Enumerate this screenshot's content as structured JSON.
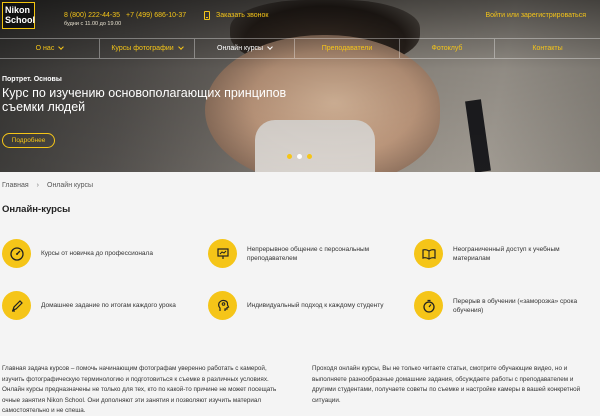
{
  "header": {
    "logo_line1": "Nikon",
    "logo_line2": "School",
    "phone1": "8 (800) 222-44-35",
    "phone2": "+7 (499) 686-10-37",
    "hours": "будни с 11.00 до 19.00",
    "callback": "Заказать звонок",
    "login": "Войти или зарегистрироваться"
  },
  "nav": [
    {
      "label": "О нас",
      "dropdown": true
    },
    {
      "label": "Курсы фотографии",
      "dropdown": true
    },
    {
      "label": "Онлайн курсы",
      "dropdown": true
    },
    {
      "label": "Преподаватели",
      "dropdown": false
    },
    {
      "label": "Фотоклуб",
      "dropdown": false
    },
    {
      "label": "Контакты",
      "dropdown": false
    }
  ],
  "hero": {
    "subtitle": "Портрет. Основы",
    "title": "Курс по изучению основополагающих принципов съемки людей",
    "button": "Подробнее"
  },
  "breadcrumb": {
    "home": "Главная",
    "current": "Онлайн курсы"
  },
  "section_title": "Онлайн-курсы",
  "features": [
    {
      "icon": "gauge-icon",
      "text": "Курсы от новичка до профессионала"
    },
    {
      "icon": "presentation-icon",
      "text": "Непрерывное общение с персональным преподавателем"
    },
    {
      "icon": "book-icon",
      "text": "Неограниченный доступ к учебным материалам"
    },
    {
      "icon": "pencil-icon",
      "text": "Домашнее задание по итогам каждого урока"
    },
    {
      "icon": "head-icon",
      "text": "Индивидуальный подход к каждому студенту"
    },
    {
      "icon": "timer-icon",
      "text": "Перерыв в обучении («заморозка» срока обучения)"
    }
  ],
  "paragraphs": {
    "left": "Главная задача курсов – помочь начинающим фотографам уверенно работать с камерой, изучить фотографическую терминологию и подготовиться к съемке в различных условиях. Онлайн курсы предназначены не только для тех, кто по какой-то причине не может посещать очные занятия Nikon School. Они дополняют эти занятия и позволяют изучить материал самостоятельно и не спеша.",
    "right": "Проходя онлайн курсы, Вы не только читаете статьи, смотрите обучающие видео, но и выполняете разнообразные домашние задания, обсуждаете работы с преподавателем и другими студентами, получаете советы по съемке и настройке камеры в вашей конкретной ситуации."
  },
  "colors": {
    "accent": "#f5c518"
  }
}
